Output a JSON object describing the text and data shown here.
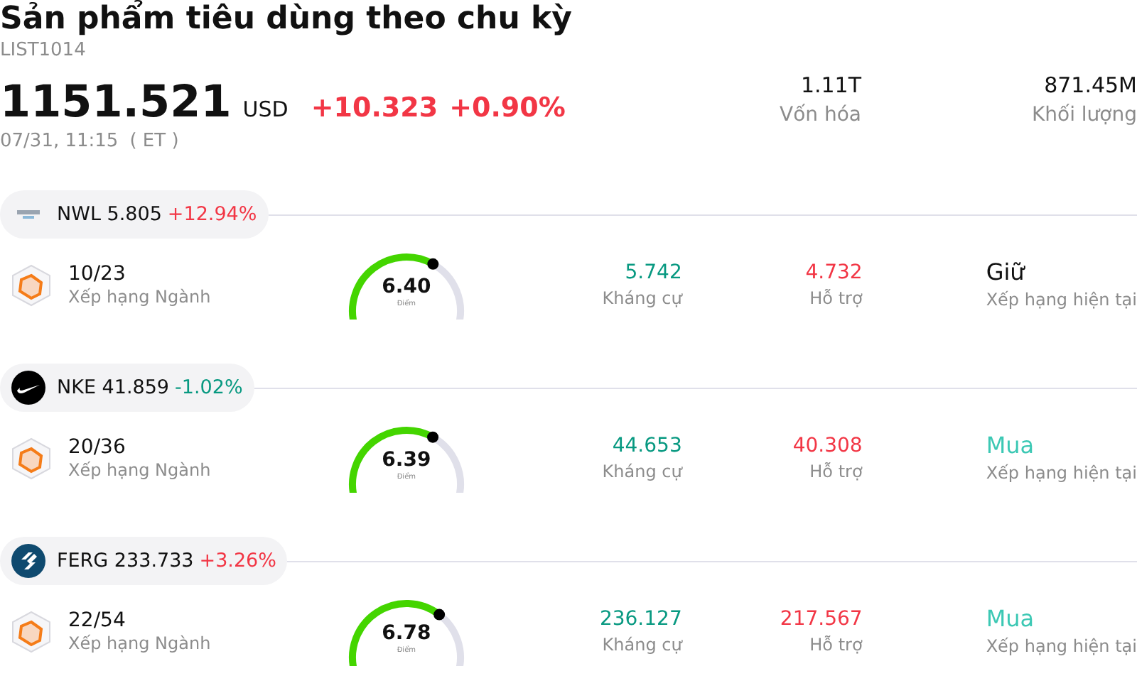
{
  "header": {
    "title": "Sản phẩm tiêu dùng theo chu kỳ",
    "code": "LIST1014",
    "price": "1151.521",
    "currency": "USD",
    "change": "+10.323",
    "change_pct": "+0.90%",
    "rising": true,
    "time": "07/31, 11:15",
    "timezone": "( ET )",
    "stats": [
      {
        "value": "1.11T",
        "label": "Vốn hóa"
      },
      {
        "value": "871.45M",
        "label": "Khối lượng"
      }
    ]
  },
  "stocks": [
    {
      "ticker": "NWL",
      "price": "5.805",
      "change": "+12.94%",
      "rising": true,
      "rank": "10/23",
      "rank_label": "Xếp hạng Ngành",
      "score": "6.40",
      "score_label": "Điểm",
      "resistance": "5.742",
      "resistance_label": "Kháng cự",
      "support": "4.732",
      "support_label": "Hỗ trợ",
      "rating": "Giữ",
      "color": "#111111",
      "rating_label": "Xếp hạng hiện tại"
    },
    {
      "ticker": "NKE",
      "price": "41.859",
      "change": "-1.02%",
      "rising": false,
      "rank": "20/36",
      "rank_label": "Xếp hạng Ngành",
      "score": "6.39",
      "score_label": "Điểm",
      "resistance": "44.653",
      "resistance_label": "Kháng cự",
      "support": "40.308",
      "support_label": "Hỗ trợ",
      "rating": "Mua",
      "color": "#3cc8b4",
      "rating_label": "Xếp hạng hiện tại"
    },
    {
      "ticker": "FERG",
      "price": "233.733",
      "change": "+3.26%",
      "rising": true,
      "rank": "22/54",
      "rank_label": "Xếp hạng Ngành",
      "score": "6.78",
      "score_label": "Điểm",
      "resistance": "236.127",
      "resistance_label": "Kháng cự",
      "support": "217.567",
      "support_label": "Hỗ trợ",
      "rating": "Mua",
      "color": "#3cc8b4",
      "rating_label": "Xếp hạng hiện tại"
    }
  ]
}
